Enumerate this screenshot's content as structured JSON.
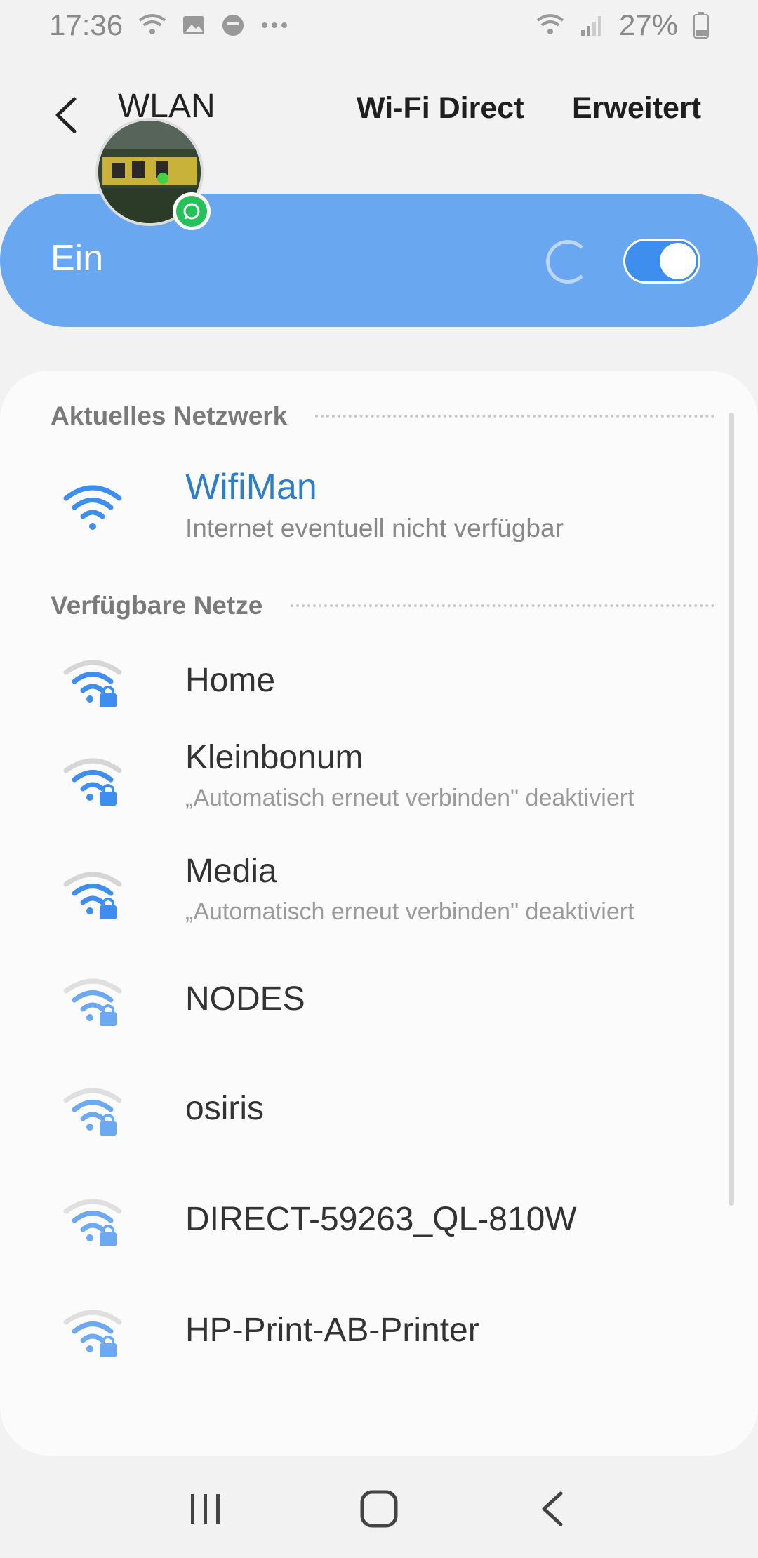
{
  "status_bar": {
    "time": "17:36",
    "battery": "27%",
    "icons": [
      "wifi-signal-icon",
      "gallery-icon",
      "smiley-icon",
      "more-dots-icon",
      "wifi-signal-icon",
      "cell-signal-icon",
      "battery-icon"
    ]
  },
  "app_bar": {
    "title": "WLAN",
    "wifi_direct": "Wi-Fi Direct",
    "advanced": "Erweitert"
  },
  "master_switch": {
    "label": "Ein",
    "on": true
  },
  "current_network": {
    "header": "Aktuelles Netzwerk",
    "name": "WifiMan",
    "status": "Internet eventuell nicht verfügbar"
  },
  "available": {
    "header": "Verfügbare Netze",
    "networks": [
      {
        "name": "Home",
        "sub": ""
      },
      {
        "name": "Kleinbonum",
        "sub": "„Automatisch erneut verbinden\" deaktiviert"
      },
      {
        "name": "Media",
        "sub": "„Automatisch erneut verbinden\" deaktiviert"
      },
      {
        "name": "NODES",
        "sub": ""
      },
      {
        "name": "osiris",
        "sub": ""
      },
      {
        "name": "DIRECT-59263_QL-810W",
        "sub": ""
      },
      {
        "name": "HP-Print-AB-Printer",
        "sub": ""
      }
    ]
  },
  "colors": {
    "accent": "#3e8ef0",
    "switch_bar": "#6aa7f1",
    "current_name": "#2f7cc7"
  }
}
